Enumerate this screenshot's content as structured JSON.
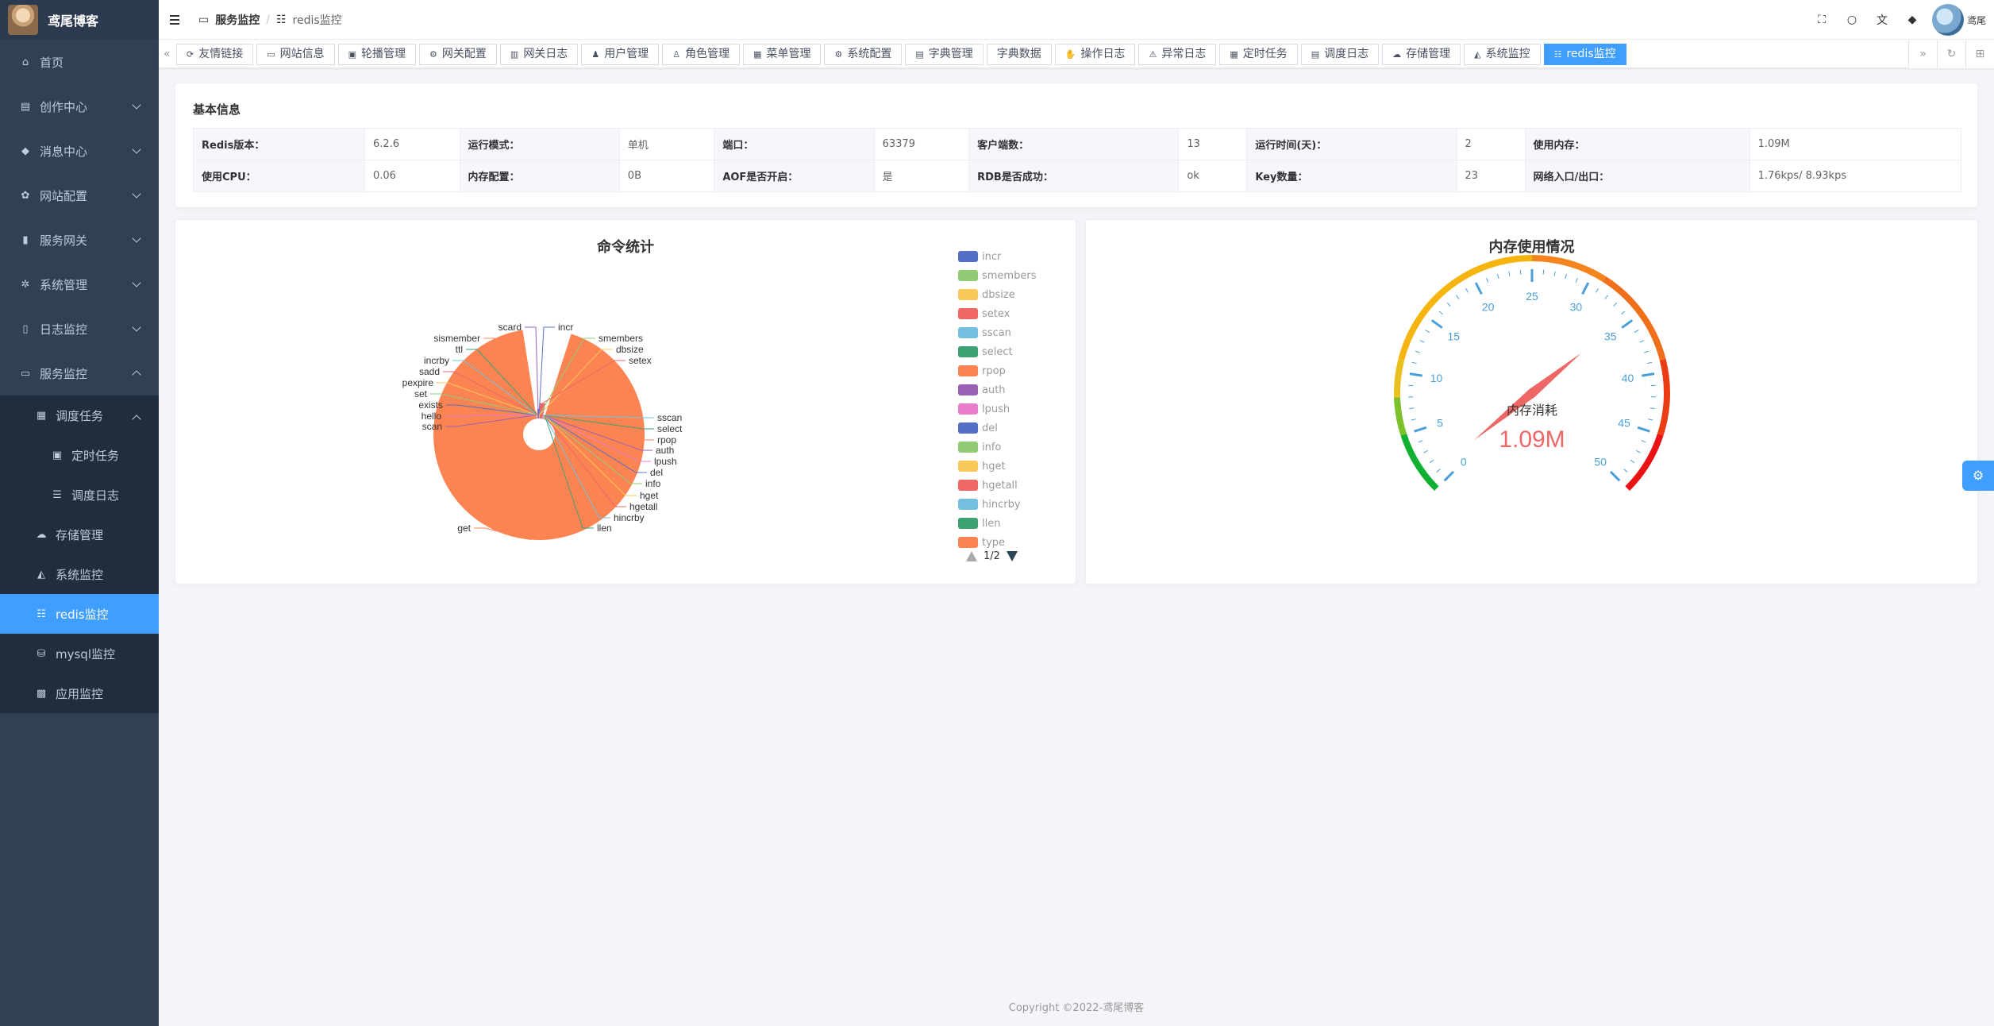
{
  "app": {
    "title": "鸢尾博客"
  },
  "sidebar": {
    "items": [
      {
        "label": "首页",
        "icon": "home-icon"
      },
      {
        "label": "创作中心",
        "icon": "document-icon"
      },
      {
        "label": "消息中心",
        "icon": "bell-icon"
      },
      {
        "label": "网站配置",
        "icon": "gear-icon"
      },
      {
        "label": "服务网关",
        "icon": "chart-icon"
      },
      {
        "label": "系统管理",
        "icon": "gear-icon"
      },
      {
        "label": "日志监控",
        "icon": "log-icon"
      },
      {
        "label": "服务监控",
        "icon": "monitor-icon"
      }
    ],
    "sub": {
      "schedule": "调度任务",
      "timed_task": "定时任务",
      "schedule_log": "调度日志",
      "storage": "存储管理",
      "system_monitor": "系统监控",
      "redis_monitor": "redis监控",
      "mysql_monitor": "mysql监控",
      "app_monitor": "应用监控"
    }
  },
  "header": {
    "breadcrumb_parent": "服务监控",
    "breadcrumb_current": "redis监控",
    "user": "鸢尾"
  },
  "tags": [
    "友情链接",
    "网站信息",
    "轮播管理",
    "网关配置",
    "网关日志",
    "用户管理",
    "角色管理",
    "菜单管理",
    "系统配置",
    "字典管理",
    "字典数据",
    "操作日志",
    "异常日志",
    "定时任务",
    "调度日志",
    "存储管理",
    "系统监控",
    "redis监控"
  ],
  "basic": {
    "title": "基本信息",
    "rows": [
      [
        "Redis版本：",
        "6.2.6",
        "运行模式：",
        "单机",
        "端口：",
        "63379",
        "客户端数：",
        "13",
        "运行时间(天)：",
        "2",
        "使用内存：",
        "1.09M"
      ],
      [
        "使用CPU：",
        "0.06",
        "内存配置：",
        "0B",
        "AOF是否开启：",
        "是",
        "RDB是否成功：",
        "ok",
        "Key数量：",
        "23",
        "网络入口/出口：",
        "1.76kps/ 8.93kps"
      ]
    ]
  },
  "command_chart": {
    "title": "命令统计",
    "legend": [
      "incr",
      "smembers",
      "dbsize",
      "setex",
      "sscan",
      "select",
      "rpop",
      "auth",
      "lpush",
      "del",
      "info",
      "hget",
      "hgetall",
      "hincrby",
      "llen",
      "type"
    ],
    "legend_colors": [
      "#5470c6",
      "#91cc75",
      "#fac858",
      "#ee6666",
      "#73c0de",
      "#3ba272",
      "#fc8452",
      "#9a60b4",
      "#ea7ccc",
      "#5470c6",
      "#91cc75",
      "#fac858",
      "#ee6666",
      "#73c0de",
      "#3ba272",
      "#fc8452"
    ],
    "page": "1/2"
  },
  "chart_data": [
    {
      "type": "pie",
      "title": "命令统计",
      "categories": [
        "incr",
        "smembers",
        "dbsize",
        "setex",
        "sscan",
        "select",
        "rpop",
        "auth",
        "lpush",
        "del",
        "info",
        "hget",
        "hgetall",
        "hincrby",
        "llen",
        "get",
        "scan",
        "hello",
        "exists",
        "set",
        "pexpire",
        "sadd",
        "incrby",
        "ttl",
        "sismember",
        "scard"
      ],
      "values": [
        1,
        1,
        1,
        18,
        1,
        1,
        1,
        1,
        1,
        1,
        1,
        1,
        1,
        1,
        1,
        600,
        1,
        1,
        1,
        1,
        1,
        1,
        1,
        1,
        1,
        7
      ],
      "labels": [
        "sscan",
        "select",
        "rpop",
        "auth",
        "lpush",
        "del",
        "info",
        "hget",
        "hgetall",
        "hincrby",
        "llen",
        "get",
        "scan",
        "hello",
        "exists",
        "set",
        "pexpire",
        "sadd",
        "incrby",
        "ttl",
        "sismember",
        "scard",
        "incr",
        "smembers",
        "dbsize",
        "setex"
      ]
    },
    {
      "type": "gauge",
      "title": "内存使用情况",
      "series_name": "内存消耗",
      "value": 1.09,
      "detail": "1.09M",
      "min": 0,
      "max": 50,
      "ticks": [
        "0",
        "5",
        "10",
        "15",
        "20",
        "25",
        "30",
        "35",
        "40",
        "45",
        "50"
      ]
    }
  ],
  "mem_chart": {
    "title": "内存使用情况",
    "series_name": "内存消耗",
    "value_text": "1.09M"
  },
  "footer": {
    "copyright": "Copyright ©2022-鸢尾博客"
  }
}
